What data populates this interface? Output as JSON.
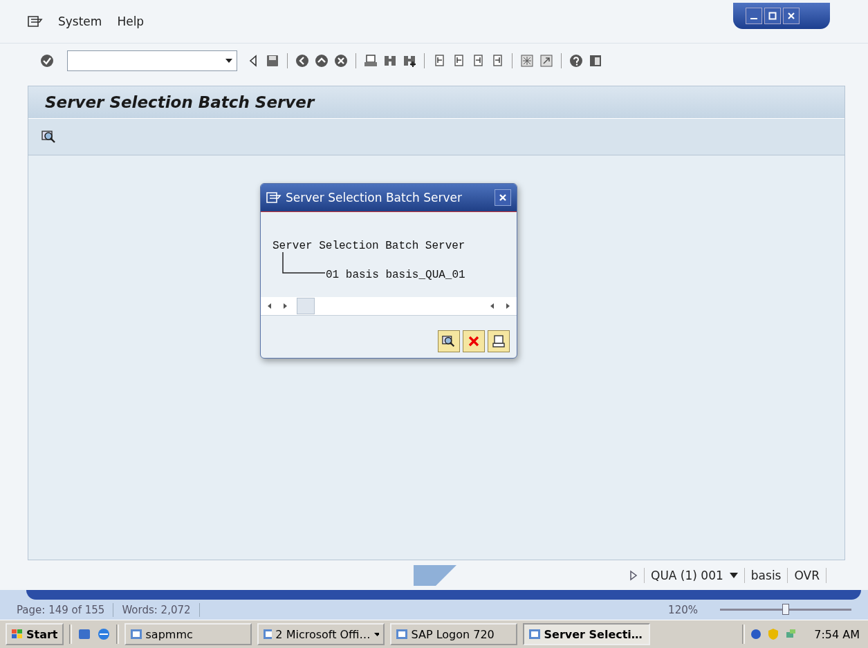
{
  "menu": [
    {
      "label": "System"
    },
    {
      "label": "Help"
    }
  ],
  "screen_title": "Server Selection Batch Server",
  "dialog": {
    "title": "Server Selection Batch Server",
    "tree": {
      "label": "Server Selection Batch Server",
      "children": [
        {
          "label": "01 basis basis_QUA_01"
        }
      ]
    }
  },
  "status_bar": {
    "system": "QUA (1) 001",
    "user": "basis",
    "mode": "OVR"
  },
  "word_status": {
    "page": "Page: 149 of 155",
    "words": "Words: 2,072",
    "zoom": "120%",
    "zoom_slider": {
      "level": 0.5
    }
  },
  "taskbar": {
    "start": "Start",
    "tasks": [
      {
        "label": "sapmmc",
        "selected": false,
        "kind": "app"
      },
      {
        "label": "2 Microsoft Offi…",
        "selected": false,
        "kind": "group"
      },
      {
        "label": "SAP Logon 720",
        "selected": false,
        "kind": "app"
      },
      {
        "label": "Server Selecti…",
        "selected": true,
        "kind": "app"
      }
    ],
    "clock": "7:54 AM"
  }
}
